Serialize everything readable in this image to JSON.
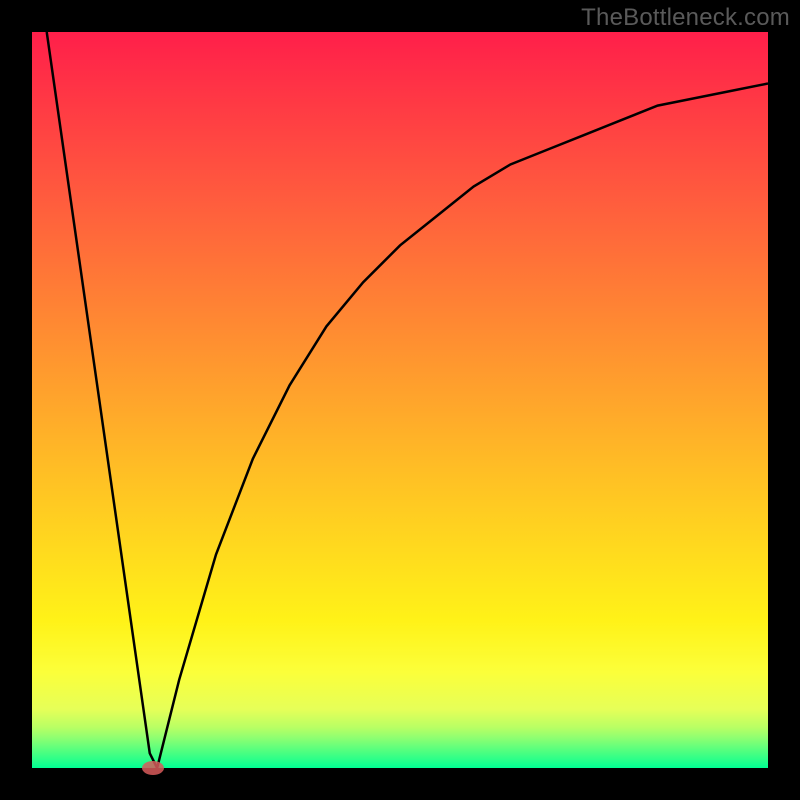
{
  "watermark": "TheBottleneck.com",
  "colors": {
    "frame": "#000000",
    "curve": "#000000",
    "marker": "#d85a5a",
    "gradient_top": "#ff1f4a",
    "gradient_bottom": "#00ff93"
  },
  "chart_data": {
    "type": "line",
    "title": "",
    "xlabel": "",
    "ylabel": "",
    "xlim": [
      0,
      100
    ],
    "ylim": [
      0,
      100
    ],
    "annotations": [],
    "series": [
      {
        "name": "bottleneck-curve",
        "x": [
          2,
          5,
          8,
          11,
          13,
          14,
          15,
          16,
          17,
          18,
          20,
          25,
          30,
          35,
          40,
          45,
          50,
          55,
          60,
          65,
          70,
          75,
          80,
          85,
          90,
          95,
          100
        ],
        "y": [
          100,
          79,
          58,
          37,
          23,
          16,
          9,
          2,
          0,
          4,
          12,
          29,
          42,
          52,
          60,
          66,
          71,
          75,
          79,
          82,
          84,
          86,
          88,
          90,
          91,
          92,
          93
        ]
      }
    ],
    "marker": {
      "x": 16.5,
      "y": 0
    }
  }
}
